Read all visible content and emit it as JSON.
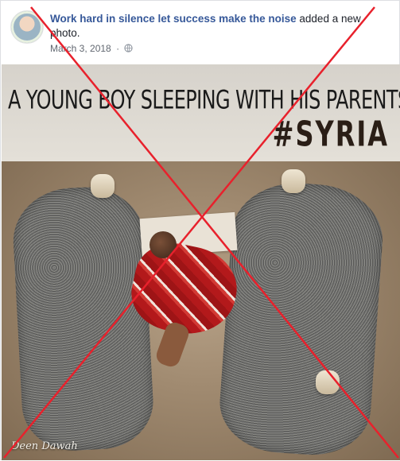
{
  "post": {
    "author": "Work hard in silence let success make the noise",
    "action": "added a new photo.",
    "date": "March 3, 2018",
    "separator": "·",
    "privacy_icon": "globe-icon"
  },
  "photo": {
    "caption_line1": "A YOUNG BOY SLEEPING WITH HIS PARENTS...",
    "caption_line2": "#SYRIA",
    "watermark": "Deen Dawah"
  },
  "overlay": {
    "mark": "red-x",
    "color": "#e8212c"
  }
}
